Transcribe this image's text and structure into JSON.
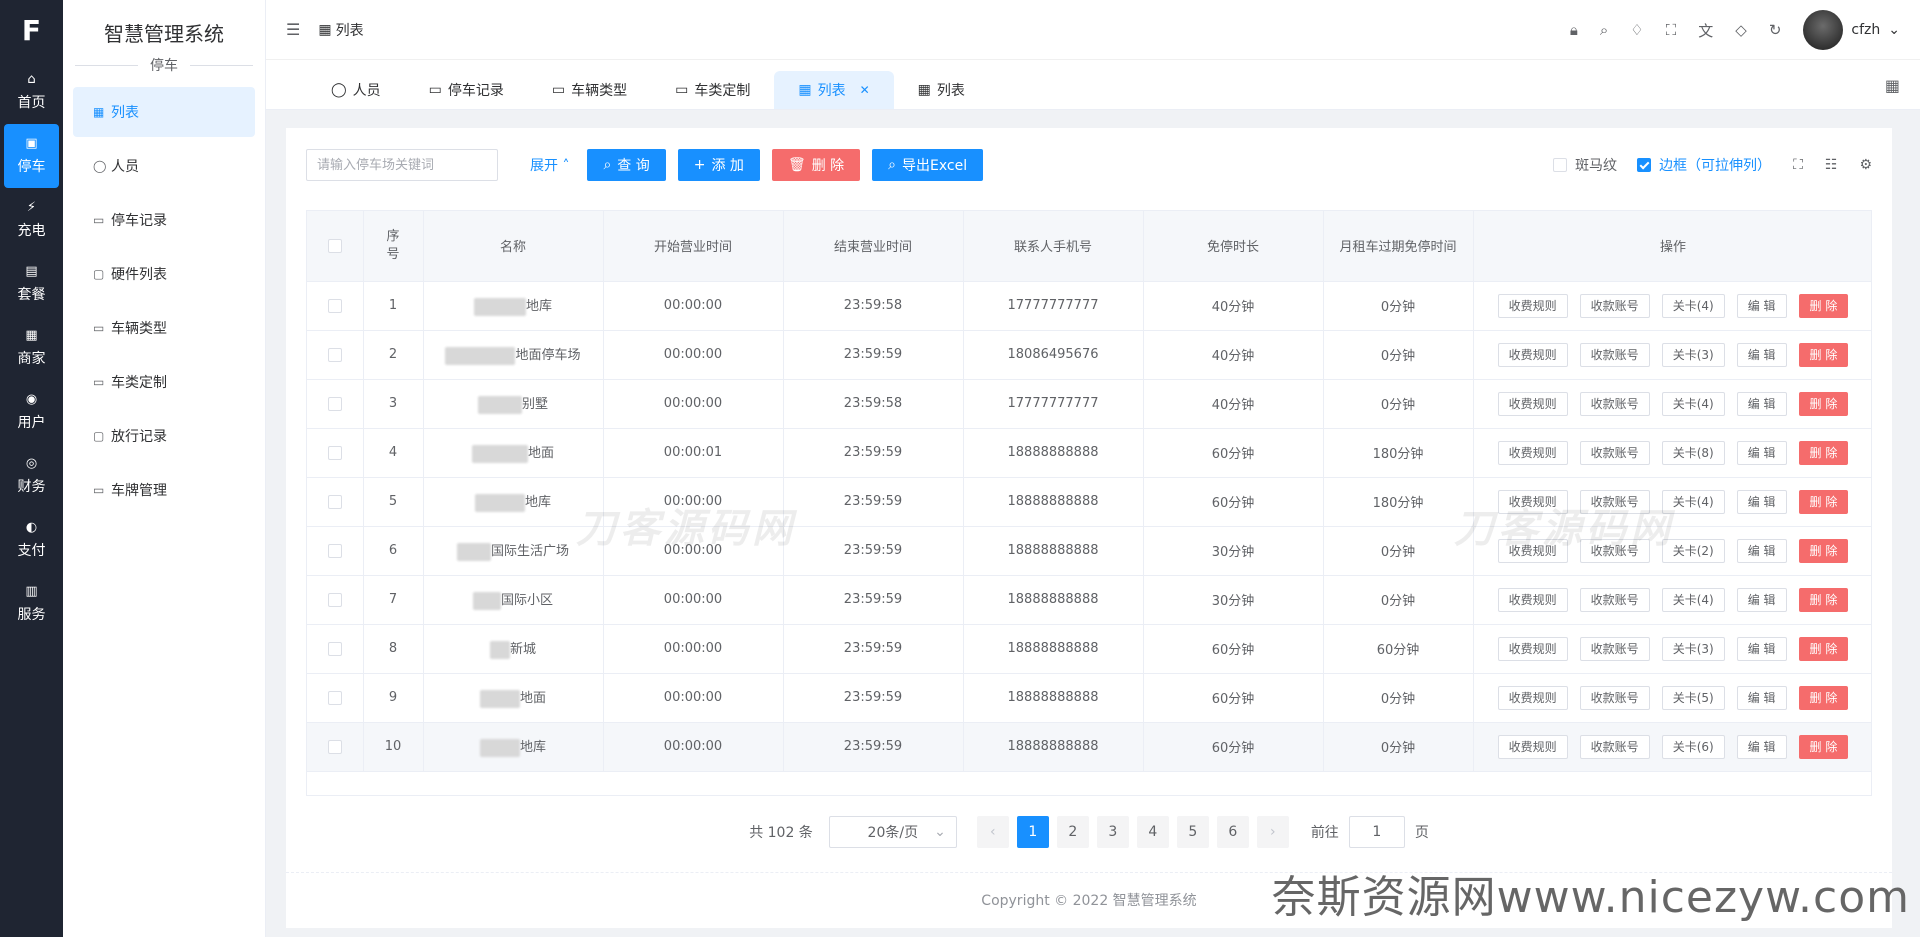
{
  "rail": {
    "logo": "F",
    "items": [
      {
        "label": "首页",
        "icon": "⌂"
      },
      {
        "label": "停车",
        "icon": "▣"
      },
      {
        "label": "充电",
        "icon": "⚡"
      },
      {
        "label": "套餐",
        "icon": "▤"
      },
      {
        "label": "商家",
        "icon": "▦"
      },
      {
        "label": "用户",
        "icon": "◉"
      },
      {
        "label": "财务",
        "icon": "◎"
      },
      {
        "label": "支付",
        "icon": "◐"
      },
      {
        "label": "服务",
        "icon": "▥"
      }
    ]
  },
  "sidebar": {
    "title": "智慧管理系统",
    "group": "停车",
    "items": [
      {
        "label": "列表",
        "icon": "▦"
      },
      {
        "label": "人员",
        "icon": "◯"
      },
      {
        "label": "停车记录",
        "icon": "▭"
      },
      {
        "label": "硬件列表",
        "icon": "▢"
      },
      {
        "label": "车辆类型",
        "icon": "▭"
      },
      {
        "label": "车类定制",
        "icon": "▭"
      },
      {
        "label": "放行记录",
        "icon": "▢"
      },
      {
        "label": "车牌管理",
        "icon": "▭"
      }
    ]
  },
  "header": {
    "breadcrumb": "列表",
    "username": "cfzh"
  },
  "tabs": [
    {
      "label": "人员",
      "icon": "◯"
    },
    {
      "label": "停车记录",
      "icon": "▭"
    },
    {
      "label": "车辆类型",
      "icon": "▭"
    },
    {
      "label": "车类定制",
      "icon": "▭"
    },
    {
      "label": "列表",
      "icon": "▦",
      "active": true
    },
    {
      "label": "列表",
      "icon": "▦"
    }
  ],
  "toolbar": {
    "search_placeholder": "请输入停车场关键词",
    "expand": "展开",
    "query": "查 询",
    "add": "添 加",
    "delete": "删 除",
    "export": "导出Excel",
    "zebra": "斑马纹",
    "border": "边框（可拉伸列）"
  },
  "table": {
    "headers": {
      "seq": "序号",
      "name": "名称",
      "start": "开始营业时间",
      "end": "结束营业时间",
      "phone": "联系人手机号",
      "free": "免停时长",
      "monthly": "月租车过期免停时间",
      "ops": "操作"
    },
    "ops": {
      "rule": "收费规则",
      "account": "收款账号",
      "edit": "编 辑",
      "del": "删 除"
    },
    "rows": [
      {
        "seq": "1",
        "name": "地库",
        "start": "00:00:00",
        "end": "23:59:58",
        "phone": "17777777777",
        "free": "40分钟",
        "monthly": "0分钟",
        "gate": "关卡(4)"
      },
      {
        "seq": "2",
        "name": "地面停车场",
        "start": "00:00:00",
        "end": "23:59:59",
        "phone": "18086495676",
        "free": "40分钟",
        "monthly": "0分钟",
        "gate": "关卡(3)"
      },
      {
        "seq": "3",
        "name": "别墅",
        "start": "00:00:00",
        "end": "23:59:58",
        "phone": "17777777777",
        "free": "40分钟",
        "monthly": "0分钟",
        "gate": "关卡(4)"
      },
      {
        "seq": "4",
        "name": "地面",
        "start": "00:00:01",
        "end": "23:59:59",
        "phone": "18888888888",
        "free": "60分钟",
        "monthly": "180分钟",
        "gate": "关卡(8)"
      },
      {
        "seq": "5",
        "name": "地库",
        "start": "00:00:00",
        "end": "23:59:59",
        "phone": "18888888888",
        "free": "60分钟",
        "monthly": "180分钟",
        "gate": "关卡(4)"
      },
      {
        "seq": "6",
        "name": "国际生活广场",
        "start": "00:00:00",
        "end": "23:59:59",
        "phone": "18888888888",
        "free": "30分钟",
        "monthly": "0分钟",
        "gate": "关卡(2)"
      },
      {
        "seq": "7",
        "name": "国际小区",
        "start": "00:00:00",
        "end": "23:59:59",
        "phone": "18888888888",
        "free": "30分钟",
        "monthly": "0分钟",
        "gate": "关卡(4)"
      },
      {
        "seq": "8",
        "name": "新城",
        "start": "00:00:00",
        "end": "23:59:59",
        "phone": "18888888888",
        "free": "60分钟",
        "monthly": "60分钟",
        "gate": "关卡(3)"
      },
      {
        "seq": "9",
        "name": "地面",
        "start": "00:00:00",
        "end": "23:59:59",
        "phone": "18888888888",
        "free": "60分钟",
        "monthly": "0分钟",
        "gate": "关卡(5)"
      },
      {
        "seq": "10",
        "name": "地库",
        "start": "00:00:00",
        "end": "23:59:59",
        "phone": "18888888888",
        "free": "60分钟",
        "monthly": "0分钟",
        "gate": "关卡(6)"
      }
    ]
  },
  "pagination": {
    "total": "共 102 条",
    "page_size": "20条/页",
    "pages": [
      "1",
      "2",
      "3",
      "4",
      "5",
      "6"
    ],
    "goto_prefix": "前往",
    "goto_value": "1",
    "goto_suffix": "页"
  },
  "footer": {
    "copyright": "Copyright © 2022 智慧管理系统"
  },
  "watermarks": {
    "overlay": "刀客源码网",
    "site": "奈斯资源网www.nicezyw.com"
  }
}
